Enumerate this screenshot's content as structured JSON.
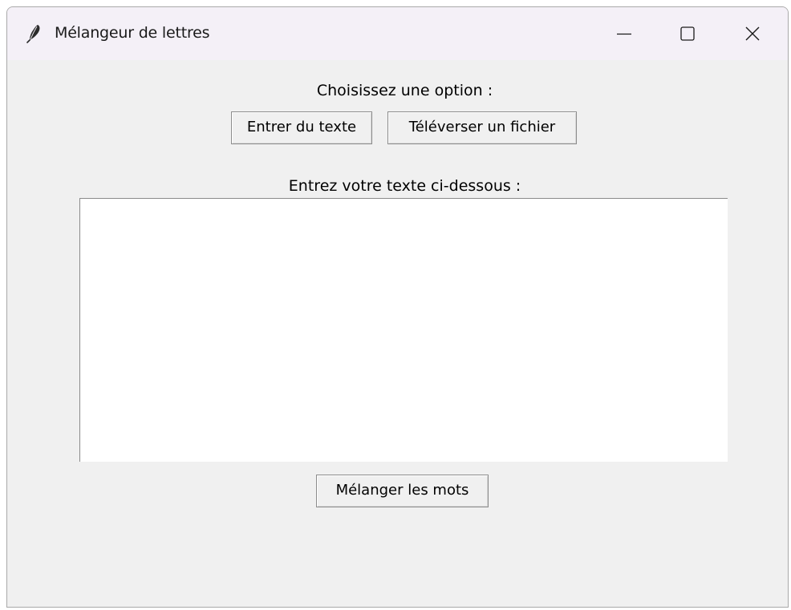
{
  "window": {
    "title": "Mélangeur de lettres",
    "icon": "feather-icon",
    "controls": {
      "minimize": "minimize-icon",
      "maximize": "maximize-icon",
      "close": "close-icon"
    }
  },
  "options": {
    "prompt": "Choisissez une option :",
    "enter_text_label": "Entrer du texte",
    "upload_file_label": "Téléverser un fichier"
  },
  "input": {
    "label": "Entrez votre texte ci-dessous :",
    "value": ""
  },
  "actions": {
    "shuffle_label": "Mélanger les mots"
  },
  "colors": {
    "window_bg": "#f0f0f0",
    "titlebar_bg": "#f4f0f7",
    "text_area_bg": "#ffffff"
  }
}
